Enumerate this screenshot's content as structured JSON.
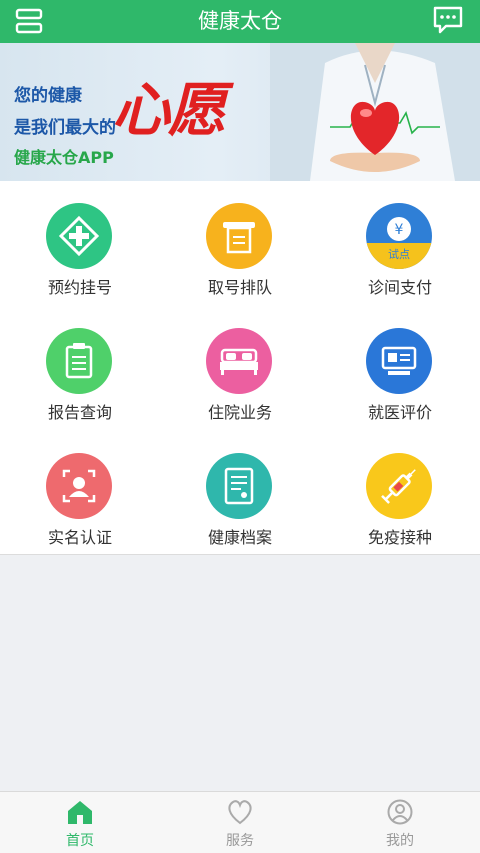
{
  "header": {
    "title": "健康太仓"
  },
  "banner": {
    "line1": "您的健康",
    "line2": "是我们最大的",
    "line3": "健康太仓APP",
    "big_text": "心愿"
  },
  "services": [
    {
      "label": "预约挂号",
      "icon": "plus-cross-icon",
      "color": "#2ec584"
    },
    {
      "label": "取号排队",
      "icon": "ticket-icon",
      "color": "#f7b21d"
    },
    {
      "label": "诊间支付",
      "icon": "yuan-coin-icon",
      "color": "#2f7fd6",
      "badge": "试点"
    },
    {
      "label": "报告查询",
      "icon": "clipboard-icon",
      "color": "#4fd06a"
    },
    {
      "label": "住院业务",
      "icon": "bed-icon",
      "color": "#ec5fa0"
    },
    {
      "label": "就医评价",
      "icon": "monitor-icon",
      "color": "#2a77d8"
    },
    {
      "label": "实名认证",
      "icon": "face-id-icon",
      "color": "#ee6a6e"
    },
    {
      "label": "健康档案",
      "icon": "document-list-icon",
      "color": "#2fb7ac"
    },
    {
      "label": "免疫接种",
      "icon": "syringe-icon",
      "color": "#f9c81b"
    }
  ],
  "tabbar": [
    {
      "label": "首页",
      "icon": "home-icon",
      "active": true
    },
    {
      "label": "服务",
      "icon": "heart-icon",
      "active": false
    },
    {
      "label": "我的",
      "icon": "user-icon",
      "active": false
    }
  ],
  "colors": {
    "brand": "#2fb86a",
    "inactive": "#999999"
  }
}
